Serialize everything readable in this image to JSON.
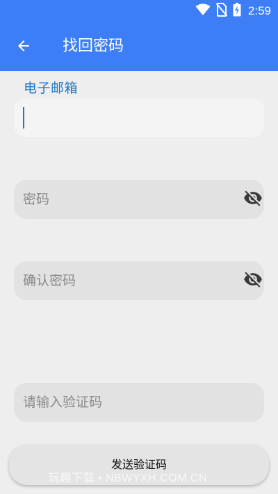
{
  "status_bar": {
    "time": "2:59",
    "icons": [
      "wifi-icon",
      "no-sim-icon",
      "battery-charging-icon"
    ]
  },
  "app_bar": {
    "back_icon": "arrow-left-icon",
    "title": "找回密码"
  },
  "form": {
    "email": {
      "label": "电子邮箱",
      "value": ""
    },
    "password": {
      "placeholder": "密码",
      "toggle_icon": "eye-off-icon"
    },
    "confirm_password": {
      "placeholder": "确认密码",
      "toggle_icon": "eye-off-icon"
    },
    "verification_code": {
      "placeholder": "请输入验证码"
    }
  },
  "actions": {
    "send_code_label": "发送验证码"
  },
  "watermark": "玩趣下载 • NBWYXH.COM.CN",
  "colors": {
    "primary": "#3d7ef6",
    "label_blue": "#1f77c6",
    "background": "#eeeeee",
    "field": "#e2e2e2",
    "icon": "#3a3a3a"
  }
}
